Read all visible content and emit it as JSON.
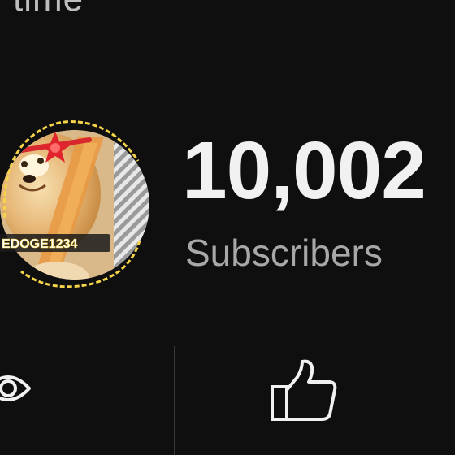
{
  "header": {
    "partial_text": "time"
  },
  "channel": {
    "avatar_label": "EDOGE1234",
    "subscriber_count": "10,002",
    "subscriber_label": "Subscribers"
  },
  "actions": {
    "views_icon": "eye-icon",
    "likes_icon": "thumbs-up-icon"
  },
  "colors": {
    "background": "#0f0f0f",
    "count_text": "#f1f1f1",
    "label_text": "#a8a8a8",
    "divider": "#3a3a3a"
  }
}
